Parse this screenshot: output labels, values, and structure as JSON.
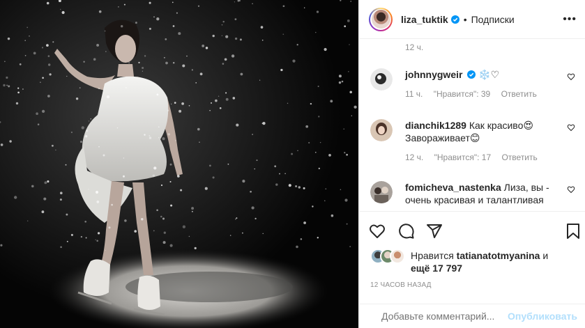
{
  "header": {
    "username": "liza_tuktik",
    "separator": "•",
    "follow_label": "Подписки",
    "more_label": "•••"
  },
  "top_comment_time": "12 ч.",
  "comments": [
    {
      "username": "johnnygweir",
      "text": "❄️♡",
      "time": "11 ч.",
      "likes": "\"Нравится\": 39",
      "reply": "Ответить"
    },
    {
      "username": "dianchik1289",
      "text": "Как красиво😍 Завораживает😊",
      "time": "12 ч.",
      "likes": "\"Нравится\": 17",
      "reply": "Ответить"
    },
    {
      "username": "fomicheva_nastenka",
      "text": "Лиза, вы - очень красивая и талантливая",
      "time": "",
      "likes": "",
      "reply": ""
    }
  ],
  "likes": {
    "prefix": "Нравится",
    "user": "tatianatotmyanina",
    "suffix": "и",
    "more": "ещё 17 797"
  },
  "time_ago": "12 ЧАСОВ НАЗАД",
  "add_comment": {
    "placeholder": "Добавьте комментарий...",
    "publish": "Опубликовать"
  },
  "colors": {
    "accent_blue": "#0095f6",
    "publish_disabled": "#b2dffc",
    "muted_text": "#8e8e8e"
  },
  "icons": [
    "heart-icon",
    "comment-icon",
    "share-icon",
    "bookmark-icon",
    "emoji-icon",
    "verified-badge-icon"
  ]
}
